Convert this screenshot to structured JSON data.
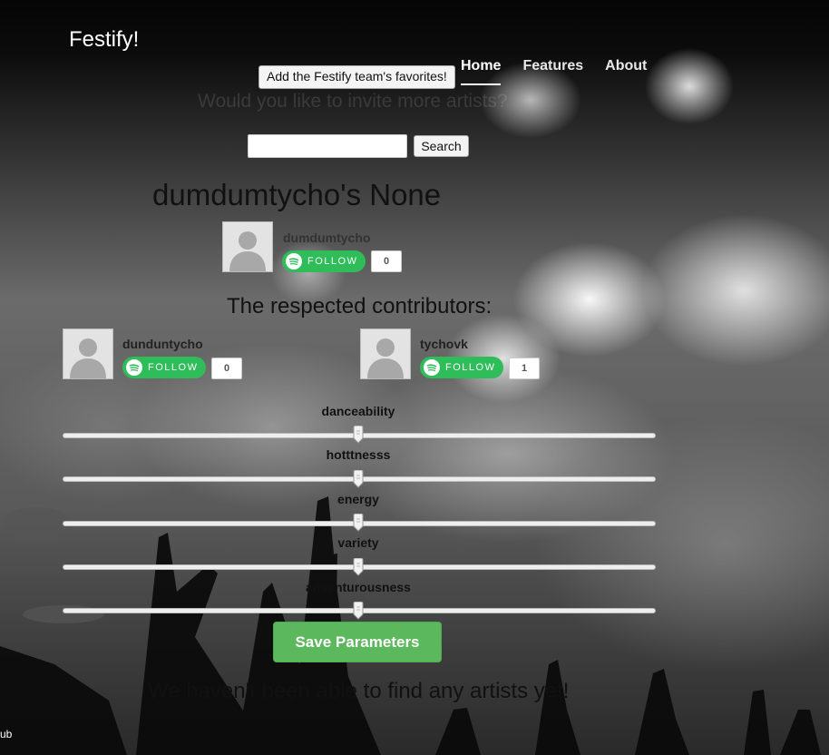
{
  "brand": "Festify!",
  "nav": [
    {
      "label": "Home",
      "active": true
    },
    {
      "label": "Features",
      "active": false
    },
    {
      "label": "About",
      "active": false
    }
  ],
  "favorites_button": "Add the Festify team's favorites!",
  "ghost_question": "Would you like to invite more artists?",
  "search": {
    "value": "",
    "placeholder": "",
    "button": "Search"
  },
  "playlist_title": "dumdumtycho's None",
  "owner": {
    "name": "dumdumtycho",
    "follow_label": "FOLLOW",
    "followers": "0"
  },
  "contributors_heading": "The respected contributors:",
  "contributors": [
    {
      "name": "dunduntycho",
      "follow_label": "FOLLOW",
      "followers": "0"
    },
    {
      "name": "tychovk",
      "follow_label": "FOLLOW",
      "followers": "1"
    }
  ],
  "parameters": [
    {
      "label": "danceability",
      "value": 0.5
    },
    {
      "label": "hotttnesss",
      "value": 0.5
    },
    {
      "label": "energy",
      "value": 0.5
    },
    {
      "label": "variety",
      "value": 0.5
    },
    {
      "label": "adventurousness",
      "value": 0.5
    }
  ],
  "save_button": "Save Parameters",
  "empty_message": "We haven't been able to find any artists yet!",
  "footer_fragment": "ub",
  "colors": {
    "follow_green": "#2ebd59",
    "save_green": "#5cb85c"
  }
}
